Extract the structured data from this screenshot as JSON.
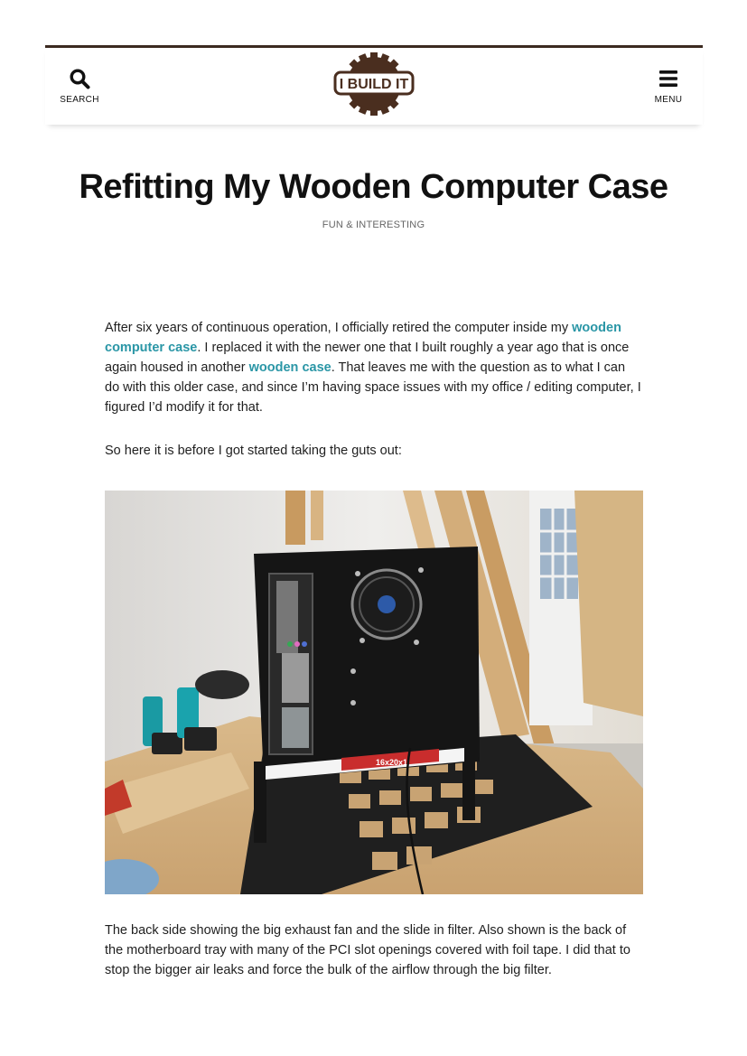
{
  "header": {
    "search_label": "SEARCH",
    "menu_label": "MENU",
    "logo_text": "I BUILD IT",
    "border_color": "#3b2a20",
    "logo_color": "#4a2e1f"
  },
  "article": {
    "title": "Refitting My Wooden Computer Case",
    "category": "FUN & INTERESTING",
    "p1": {
      "t1": "After six years of continuous operation, I officially retired the computer inside my ",
      "link1": "wooden computer case",
      "t2": ". I replaced it with the newer one that I built roughly a year ago that is once again housed in another ",
      "link2": "wooden case",
      "t3": ". That leaves me with the question as to what I can do with this older case, and since I’m having space issues with my office / editing computer, I figured I’d modify it for that."
    },
    "p2": "So here it is before I got started taking the guts out:",
    "photo_label": "16x20x1",
    "p3": "The back side showing the big exhaust fan and the slide in filter. Also shown is the back of the motherboard tray with many of the PCI slot openings covered with foil tape. I did that to stop the bigger air leaks and force the bulk of the airflow through the big filter.",
    "link_color": "#2a96a6"
  }
}
